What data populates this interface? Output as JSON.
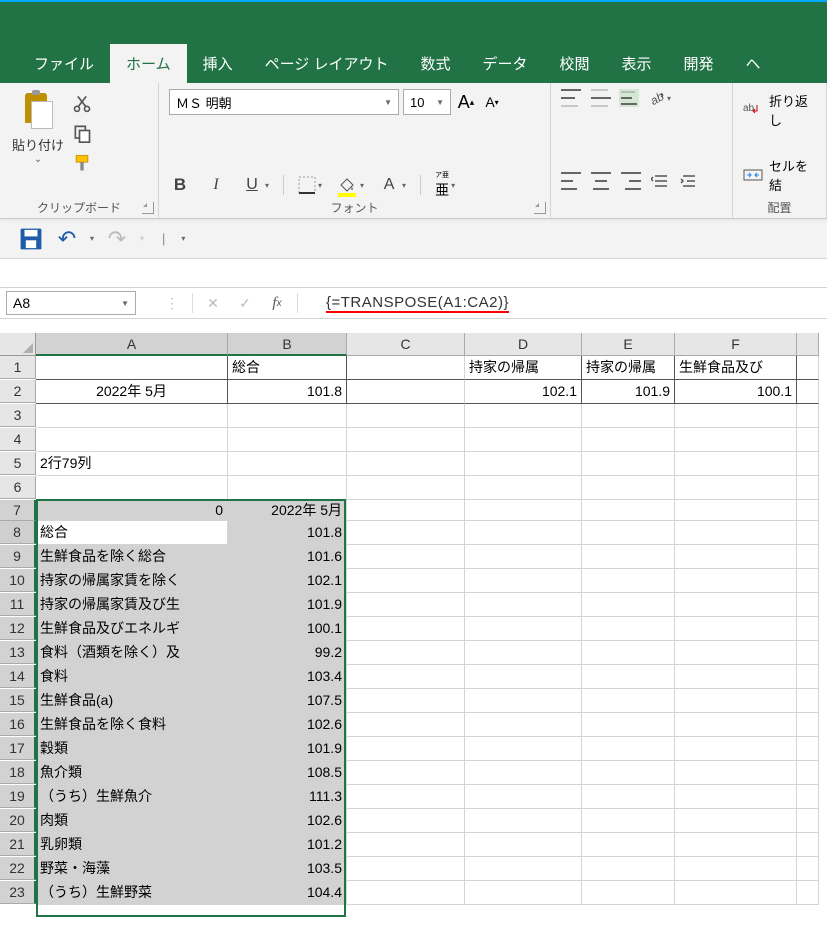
{
  "tabs": [
    "ファイル",
    "ホーム",
    "挿入",
    "ページ レイアウト",
    "数式",
    "データ",
    "校閲",
    "表示",
    "開発",
    "ヘ"
  ],
  "active_tab": 1,
  "clipboard": {
    "paste": "貼り付け",
    "dd": "⌄",
    "group": "クリップボード"
  },
  "font": {
    "name": "ＭＳ 明朝",
    "size": "10",
    "bold": "B",
    "italic": "I",
    "underline": "U",
    "ruby": "ア亜",
    "group": "フォント",
    "bigA": "A",
    "smallA": "A",
    "A": "A"
  },
  "align": {
    "group": "配置"
  },
  "cells": {
    "wrap": "折り返し",
    "merge": "セルを結",
    "abc": "ab"
  },
  "nameBox": "A8",
  "formula": "{=TRANSPOSE(A1:CA2)}",
  "cols": [
    "A",
    "B",
    "C",
    "D",
    "E",
    "F"
  ],
  "rows": [
    1,
    2,
    3,
    4,
    5,
    6,
    7,
    8,
    9,
    10,
    11,
    12,
    13,
    14,
    15,
    16,
    17,
    18,
    19,
    20,
    21,
    22,
    23
  ],
  "data_top": {
    "r1": {
      "B": "総合",
      "D": "持家の帰属",
      "E": "持家の帰属",
      "F": "生鮮食品及び"
    },
    "r2": {
      "A": "2022年 5月",
      "B": "101.8",
      "D": "102.1",
      "E": "101.9",
      "F": "100.1"
    },
    "r5": {
      "A": "2行79列"
    },
    "r7": {
      "A": "0",
      "B": "2022年 5月"
    }
  },
  "transposed": [
    {
      "a": "総合",
      "b": "101.8"
    },
    {
      "a": "生鮮食品を除く総合",
      "b": "101.6"
    },
    {
      "a": "持家の帰属家賃を除く",
      "b": "102.1"
    },
    {
      "a": "持家の帰属家賃及び生",
      "b": "101.9"
    },
    {
      "a": "生鮮食品及びエネルギ",
      "b": "100.1"
    },
    {
      "a": "食料（酒類を除く）及",
      "b": "99.2"
    },
    {
      "a": "食料",
      "b": "103.4"
    },
    {
      "a": "生鮮食品(a)",
      "b": "107.5"
    },
    {
      "a": "生鮮食品を除く食料",
      "b": "102.6"
    },
    {
      "a": "穀類",
      "b": "101.9"
    },
    {
      "a": "魚介類",
      "b": "108.5"
    },
    {
      "a": "（うち）生鮮魚介",
      "b": "111.3"
    },
    {
      "a": "肉類",
      "b": "102.6"
    },
    {
      "a": "乳卵類",
      "b": "101.2"
    },
    {
      "a": "野菜・海藻",
      "b": "103.5"
    },
    {
      "a": "（うち）生鮮野菜",
      "b": "104.4"
    }
  ]
}
